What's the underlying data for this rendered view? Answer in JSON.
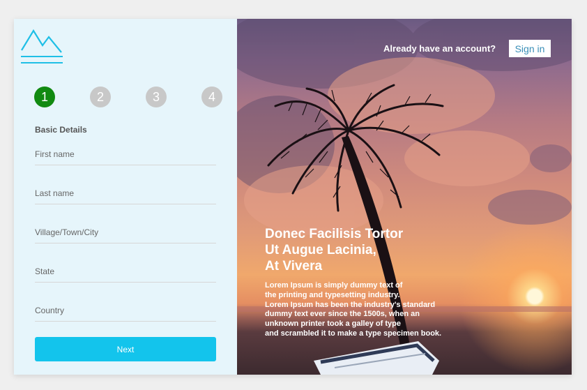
{
  "logo": {
    "icon": "mountain-logo-icon",
    "color": "#1fbfe6"
  },
  "steps": [
    "1",
    "2",
    "3",
    "4"
  ],
  "active_step": "1",
  "form": {
    "section_title": "Basic Details",
    "fields": [
      {
        "name": "first-name-field",
        "placeholder": "First name",
        "value": ""
      },
      {
        "name": "last-name-field",
        "placeholder": "Last name",
        "value": ""
      },
      {
        "name": "city-field",
        "placeholder": "Village/Town/City",
        "value": ""
      },
      {
        "name": "state-field",
        "placeholder": "State",
        "value": ""
      },
      {
        "name": "country-field",
        "placeholder": "Country",
        "value": ""
      }
    ],
    "next_label": "Next"
  },
  "hero": {
    "already_text": "Already have an account?",
    "signin_label": "Sign in",
    "title_lines": [
      "Donec Facilisis Tortor",
      "Ut Augue Lacinia,",
      "At Vivera"
    ],
    "text_lines": [
      "Lorem Ipsum is simply dummy text of",
      "the printing and typesetting industry.",
      "Lorem Ipsum has been the industry's standard",
      "dummy text ever since the 1500s, when an",
      "unknown printer took a galley of type",
      "and scrambled it to make a type specimen book."
    ]
  },
  "colors": {
    "accent": "#13c4ec",
    "active_step": "#118a11",
    "inactive_step": "#c8c8c8",
    "panel_bg": "#e6f5fb",
    "signin_text": "#3a8fb7"
  }
}
